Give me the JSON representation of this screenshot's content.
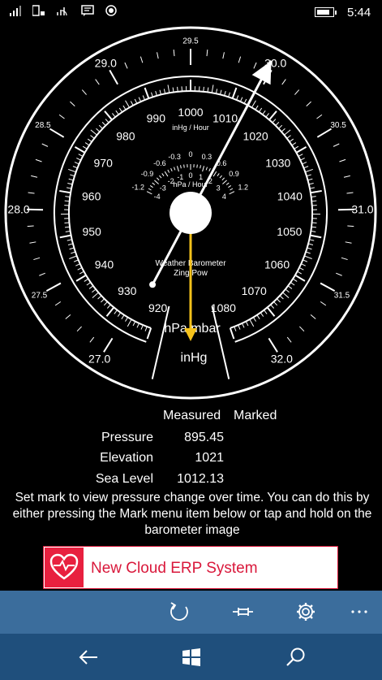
{
  "status": {
    "time": "5:44",
    "icons": [
      "signal-icon",
      "sim-signal-icon",
      "wifi-icon",
      "message-icon",
      "location-icon",
      "battery-icon"
    ]
  },
  "gauge": {
    "pressure_scale": [
      "920",
      "930",
      "940",
      "950",
      "960",
      "970",
      "980",
      "990",
      "1000",
      "1010",
      "1020",
      "1030",
      "1040",
      "1050",
      "1060",
      "1070",
      "1080"
    ],
    "inhg_scale": [
      "27.0",
      "27.5",
      "28.0",
      "28.5",
      "29.0",
      "29.5",
      "30.0",
      "30.5",
      "31.0",
      "31.5",
      "32.0"
    ],
    "trend_inhg_labels": [
      "-1.2",
      "-0.9",
      "-0.6",
      "-0.3",
      "0",
      "0.3",
      "0.6",
      "0.9",
      "1.2"
    ],
    "trend_hpa_labels": [
      "-4",
      "-3",
      "-2",
      "-1",
      "0",
      "1",
      "2",
      "3",
      "4"
    ],
    "trend_inhg_title": "inHg / Hour",
    "trend_hpa_title": "hPa / Hour",
    "brand_line1": "Weather Barometer",
    "brand_line2": "Zing Pow",
    "unit_primary": "hPa mbar",
    "unit_secondary": "inHg",
    "measured_hpa": 895.45,
    "marked_indicator_hpa": 1012.13
  },
  "readings": {
    "measured_header": "Measured",
    "marked_header": "Marked",
    "rows": [
      {
        "label": "Pressure",
        "value": "895.45"
      },
      {
        "label": "Elevation",
        "value": "1021"
      },
      {
        "label": "Sea Level",
        "value": "1012.13"
      }
    ]
  },
  "note": "Set mark to view pressure change over time. You can do this by either pressing the Mark menu item below or tap and hold on the barometer image",
  "ad": {
    "text": "New Cloud ERP System",
    "accent": "#d9183b"
  },
  "appbar": {
    "color": "#3b6d9c",
    "buttons": [
      "refresh-icon",
      "mark-pin-icon",
      "settings-icon",
      "more-icon"
    ]
  },
  "navbar": {
    "color": "#1f4f7c",
    "buttons": [
      "back-icon",
      "windows-icon",
      "search-icon"
    ]
  }
}
